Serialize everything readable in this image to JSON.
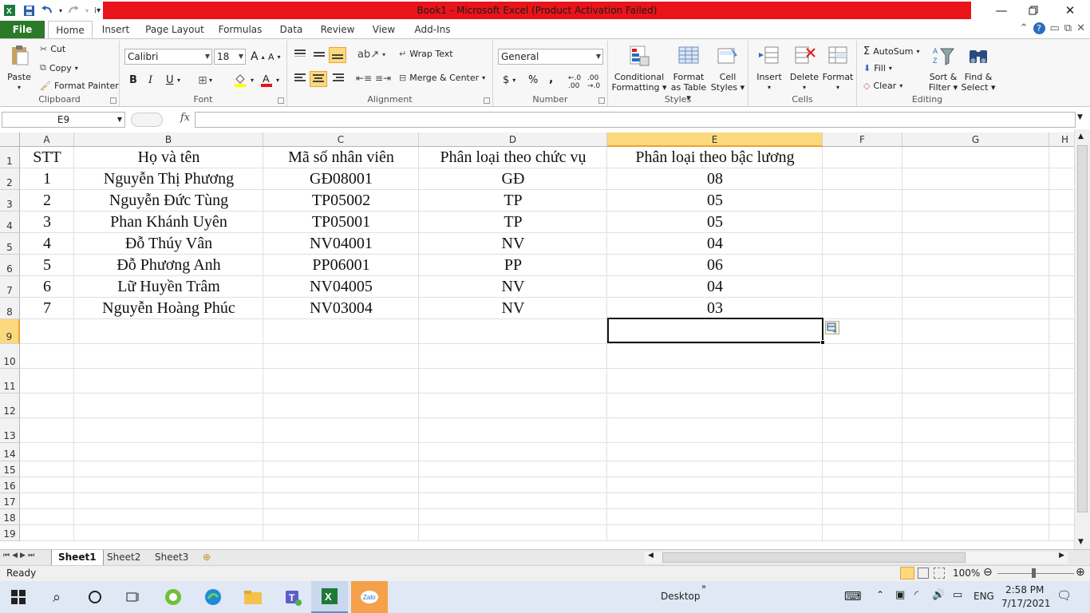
{
  "window": {
    "title": "Book1  -  Microsoft Excel (Product Activation Failed)",
    "minimize_icon": "minimize-icon",
    "restore_icon": "restore-icon",
    "close_icon": "close-icon"
  },
  "colors": {
    "title_bar": "#e8141a",
    "file_tab": "#2a7a2a",
    "selected_header": "#fcd97c"
  },
  "tabs": [
    "File",
    "Home",
    "Insert",
    "Page Layout",
    "Formulas",
    "Data",
    "Review",
    "View",
    "Add-Ins"
  ],
  "ribbon": {
    "clipboard": {
      "paste": "Paste",
      "cut": "Cut",
      "copy": "Copy",
      "format_painter": "Format Painter",
      "label": "Clipboard"
    },
    "font": {
      "name": "Calibri",
      "size": "18",
      "bold": "B",
      "italic": "I",
      "underline": "U",
      "label": "Font"
    },
    "alignment": {
      "wrap_text": "Wrap Text",
      "merge_center": "Merge & Center",
      "label": "Alignment"
    },
    "number": {
      "format": "General",
      "currency": "$",
      "percent": "%",
      "comma": ",",
      "label": "Number"
    },
    "styles": {
      "conditional": "Conditional",
      "conditional2": "Formatting",
      "format_as": "Format",
      "format_as2": "as Table",
      "cell": "Cell",
      "cell2": "Styles",
      "label": "Styles"
    },
    "cells": {
      "insert": "Insert",
      "delete": "Delete",
      "format": "Format",
      "label": "Cells"
    },
    "editing": {
      "autosum": "AutoSum",
      "fill": "Fill",
      "clear": "Clear",
      "sort": "Sort &",
      "sort2": "Filter",
      "find": "Find &",
      "find2": "Select",
      "label": "Editing"
    }
  },
  "formula_bar": {
    "name_box": "E9",
    "fx": "fx",
    "formula": ""
  },
  "columns": [
    "A",
    "B",
    "C",
    "D",
    "E",
    "F",
    "G",
    "H"
  ],
  "rows": [
    "1",
    "2",
    "3",
    "4",
    "5",
    "6",
    "7",
    "8",
    "9",
    "10",
    "11",
    "12",
    "13",
    "14",
    "15",
    "16",
    "17",
    "18",
    "19"
  ],
  "table": {
    "headers": [
      "STT",
      "Họ và tên",
      "Mã số nhân viên",
      "Phân loại theo chức vụ",
      "Phân loại theo bậc lương"
    ],
    "rows": [
      [
        "1",
        "Nguyễn Thị Phương",
        "GĐ08001",
        "GĐ",
        "08"
      ],
      [
        "2",
        "Nguyễn Đức Tùng",
        "TP05002",
        "TP",
        "05"
      ],
      [
        "3",
        "Phan Khánh Uyên",
        "TP05001",
        "TP",
        "05"
      ],
      [
        "4",
        "Đỗ Thúy Vân",
        "NV04001",
        "NV",
        "04"
      ],
      [
        "5",
        "Đỗ Phương Anh",
        "PP06001",
        "PP",
        "06"
      ],
      [
        "6",
        "Lữ Huyền Trâm",
        "NV04005",
        "NV",
        "04"
      ],
      [
        "7",
        "Nguyễn Hoàng Phúc",
        "NV03004",
        "NV",
        "03"
      ]
    ]
  },
  "sheets": [
    "Sheet1",
    "Sheet2",
    "Sheet3"
  ],
  "status": {
    "ready": "Ready",
    "zoom": "100%"
  },
  "taskbar": {
    "desktop": "Desktop",
    "lang": "ENG",
    "time": "2:58 PM",
    "date": "7/17/2021"
  }
}
